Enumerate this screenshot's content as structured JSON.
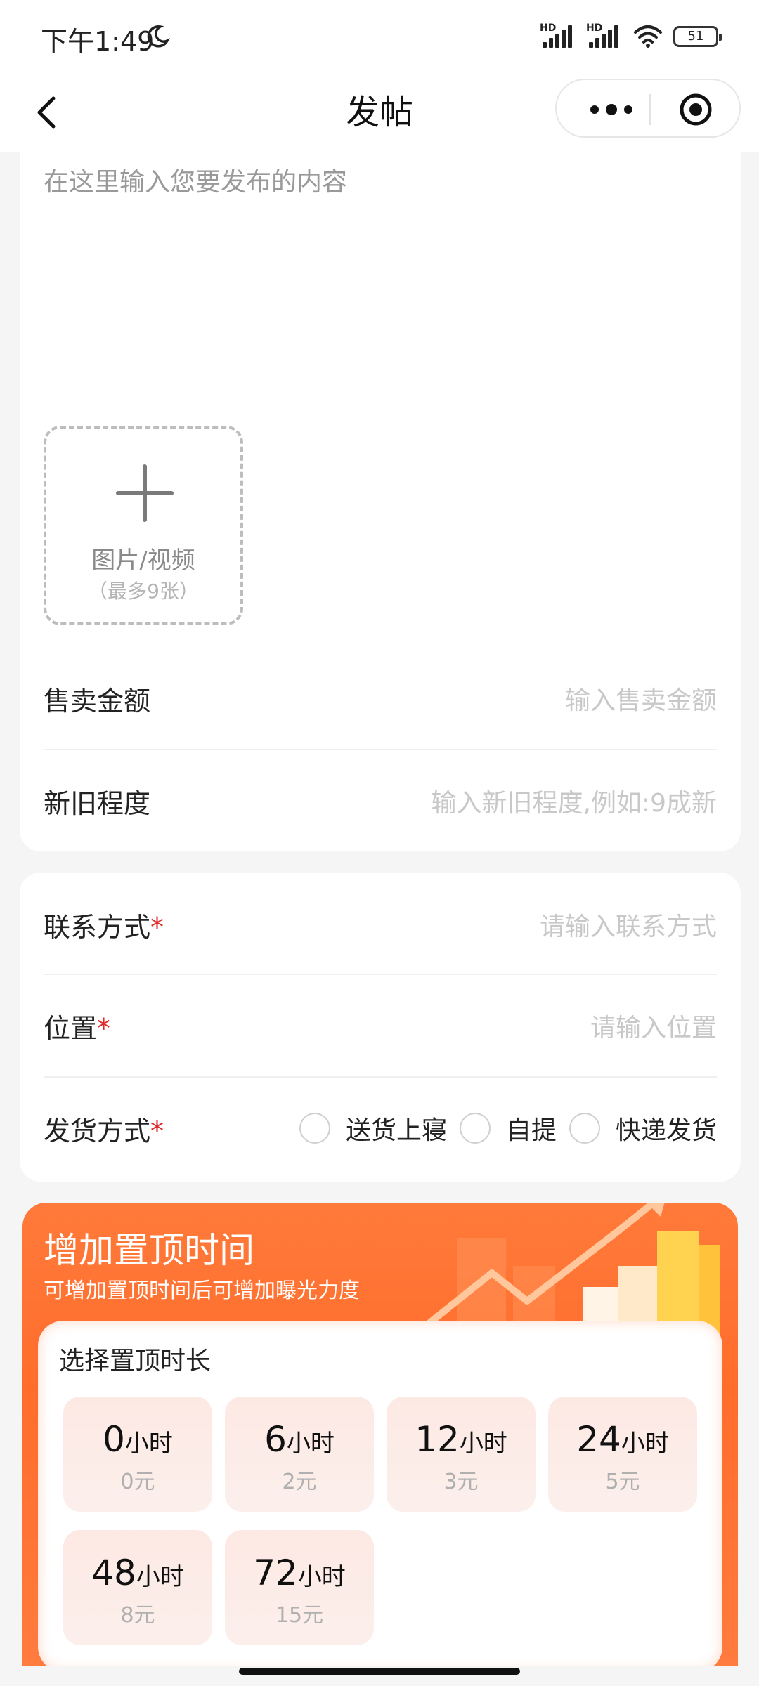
{
  "status_bar": {
    "time": "下午1:49",
    "network_1": "HD",
    "network_2": "HD",
    "battery": "51"
  },
  "nav": {
    "title": "发帖"
  },
  "editor": {
    "placeholder": "在这里输入您要发布的内容",
    "upload_label": "图片/视频",
    "upload_sub": "（最多9张）"
  },
  "fields": {
    "price": {
      "label": "售卖金额",
      "placeholder": "输入售卖金额"
    },
    "condition": {
      "label": "新旧程度",
      "placeholder": "输入新旧程度,例如:9成新"
    },
    "contact": {
      "label": "联系方式",
      "required": "*",
      "placeholder": "请输入联系方式"
    },
    "location": {
      "label": "位置",
      "required": "*",
      "placeholder": "请输入位置"
    },
    "shipping": {
      "label": "发货方式",
      "required": "*",
      "options": [
        "送货上寝",
        "自提",
        "快递发货"
      ]
    }
  },
  "promotion": {
    "title": "增加置顶时间",
    "subtitle": "可增加置顶时间后可增加曝光力度",
    "select_title": "选择置顶时长",
    "options": [
      {
        "hours": "0",
        "unit": "小时",
        "price": "0元"
      },
      {
        "hours": "6",
        "unit": "小时",
        "price": "2元"
      },
      {
        "hours": "12",
        "unit": "小时",
        "price": "3元"
      },
      {
        "hours": "24",
        "unit": "小时",
        "price": "5元"
      },
      {
        "hours": "48",
        "unit": "小时",
        "price": "8元"
      },
      {
        "hours": "72",
        "unit": "小时",
        "price": "15元"
      }
    ]
  },
  "colors": {
    "accent": "#ff6d2c",
    "required": "#e02a2a",
    "option_bg": "#fde9e4"
  }
}
